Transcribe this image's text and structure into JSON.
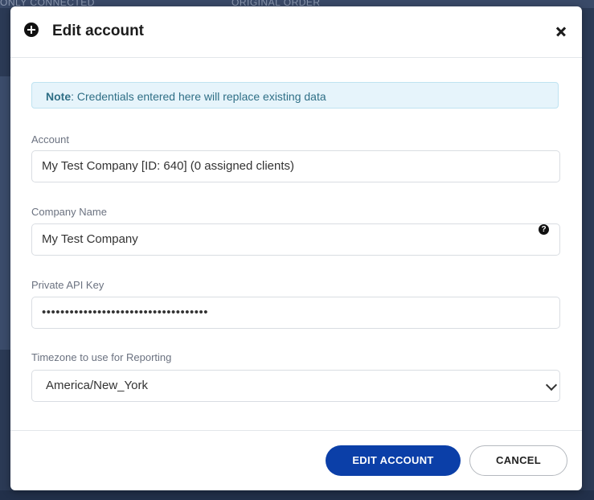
{
  "background": {
    "col_1": "ONLY CONNECTED",
    "col_2": "ORIGINAL ORDER"
  },
  "modal": {
    "title": "Edit account",
    "title_icon": "plus-circle-icon",
    "close_icon": "close-icon"
  },
  "note": {
    "label": "Note",
    "text": ": Credentials entered here will replace existing data"
  },
  "fields": {
    "account": {
      "label": "Account",
      "value": "My Test Company [ID: 640] (0 assigned clients)"
    },
    "company_name": {
      "label": "Company Name",
      "value": "My Test Company",
      "help_icon": "question-circle-icon"
    },
    "api_key": {
      "label": "Private API Key",
      "value": "••••••••••••••••••••••••••••••••••••"
    },
    "timezone": {
      "label": "Timezone to use for Reporting",
      "value": "America/New_York"
    }
  },
  "buttons": {
    "edit": "EDIT ACCOUNT",
    "cancel": "CANCEL"
  },
  "colors": {
    "primary": "#0b3fa8",
    "note_bg": "#e6f4fb",
    "note_text": "#2f6f86",
    "backdrop": "#2b3a55"
  }
}
